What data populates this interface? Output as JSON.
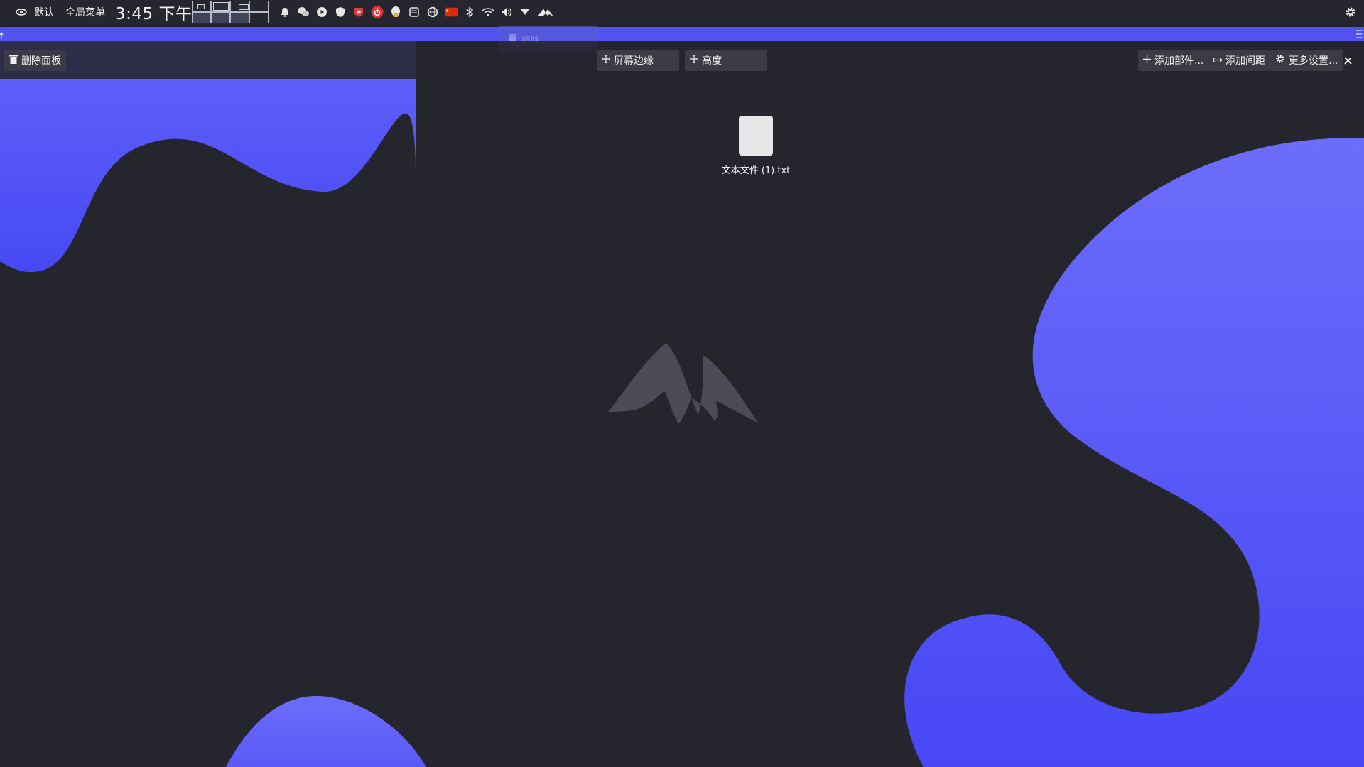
{
  "colors": {
    "background": "#25252e",
    "accent_blue": "#5152f0",
    "blob_light": "#6a6afb",
    "blob_dark": "#4646f5",
    "panel": "#25262f"
  },
  "top_panel": {
    "app_icon": "eye-icon",
    "label_default": "默认",
    "label_global_menu": "全局菜单",
    "clock": "3:45 下午",
    "tray_icons": [
      "bell-icon",
      "wechat-icon",
      "play-circle-icon",
      "shield-icon",
      "heart-badge-icon",
      "netease-music-icon",
      "qq-icon",
      "keyboard-icon",
      "globe-icon",
      "flag-cn-icon",
      "bluetooth-icon",
      "wifi-icon",
      "volume-icon",
      "chevron-down-icon",
      "mountain-logo-icon"
    ],
    "settings_icon": "gear-icon"
  },
  "edit_strip": {
    "remove_label": "移除"
  },
  "toolbar": {
    "delete_panel": "删除面板",
    "screen_edge": "屏幕边缘",
    "height": "高度",
    "add_widget": "添加部件...",
    "add_spacer": "添加间距",
    "more_settings": "更多设置..."
  },
  "desktop": {
    "file_name": "文本文件 (1).txt",
    "center_logo": "mountain-logo"
  }
}
